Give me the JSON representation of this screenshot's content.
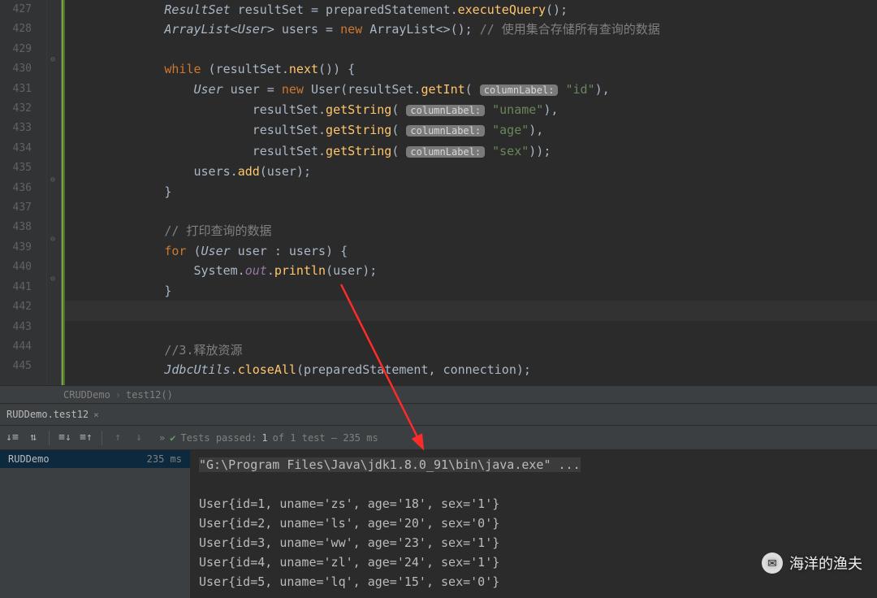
{
  "gutter": {
    "start": 427,
    "end": 445
  },
  "code": {
    "l427": {
      "t1": "ResultSet",
      "v1": "resultSet",
      "op": "=",
      "v2": "preparedStatement",
      "m": "executeQuery",
      "tail": "();"
    },
    "l428": {
      "t1": "ArrayList",
      "t2": "User",
      "v1": "users",
      "kw": "new",
      "t3": "ArrayList",
      "tail": "<>();",
      "comment": "// 使用集合存储所有查询的数据"
    },
    "l430": {
      "kw": "while",
      "v": "resultSet",
      "m": "next",
      "tail": "()) {"
    },
    "l431": {
      "t": "User",
      "v": "user",
      "kw": "new",
      "ctor": "User",
      "obj": "resultSet",
      "m": "getInt",
      "hint": "columnLabel:",
      "str": "\"id\"",
      "tail": "),"
    },
    "l432": {
      "obj": "resultSet",
      "m": "getString",
      "hint": "columnLabel:",
      "str": "\"uname\"",
      "tail": "),"
    },
    "l433": {
      "obj": "resultSet",
      "m": "getString",
      "hint": "columnLabel:",
      "str": "\"age\"",
      "tail": "),"
    },
    "l434": {
      "obj": "resultSet",
      "m": "getString",
      "hint": "columnLabel:",
      "str": "\"sex\"",
      "tail": "));"
    },
    "l435": {
      "obj": "users",
      "m": "add",
      "arg": "user",
      "tail": ");"
    },
    "l436": "}",
    "l438": "// 打印查询的数据",
    "l439": {
      "kw": "for",
      "t": "User",
      "v1": "user",
      "v2": "users",
      "tail": ") {"
    },
    "l440": {
      "cls": "System",
      "f": "out",
      "m": "println",
      "arg": "user",
      "tail": ");"
    },
    "l441": "}",
    "l443": "//3.释放资源",
    "l444": {
      "cls": "JdbcUtils",
      "m": "closeAll",
      "a1": "preparedStatement",
      "a2": "connection",
      "tail": ");"
    }
  },
  "breadcrumb": {
    "a": "CRUDDemo",
    "b": "test12()"
  },
  "tab": {
    "label": "RUDDemo.test12",
    "close": "×"
  },
  "toolbar": {
    "status_prefix": "Tests passed:",
    "status_count": "1",
    "status_suffix": "of 1 test – 235 ms"
  },
  "tree": {
    "name": "RUDDemo",
    "time": "235 ms"
  },
  "console": {
    "cmd": "\"G:\\Program Files\\Java\\jdk1.8.0_91\\bin\\java.exe\" ...",
    "lines": [
      "User{id=1, uname='zs', age='18', sex='1'}",
      "User{id=2, uname='ls', age='20', sex='0'}",
      "User{id=3, uname='ww', age='23', sex='1'}",
      "User{id=4, uname='zl', age='24', sex='1'}",
      "User{id=5, uname='lq', age='15', sex='0'}"
    ]
  },
  "branding": "海洋的渔夫"
}
